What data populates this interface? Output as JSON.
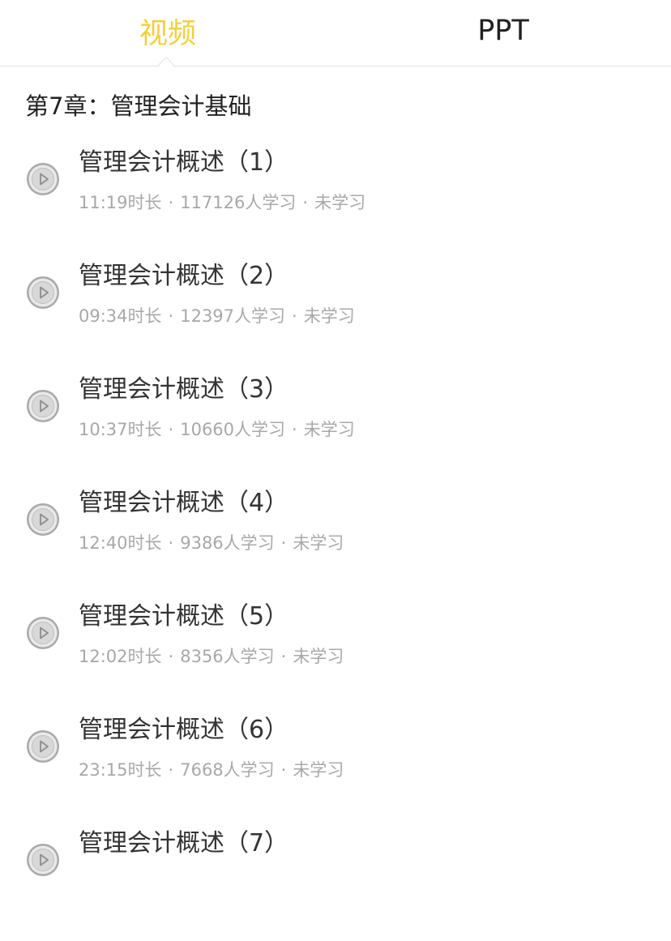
{
  "tabs": [
    {
      "label": "视频",
      "active": true
    },
    {
      "label": "PPT",
      "active": false
    }
  ],
  "colors": {
    "accent": "#f2cf3b",
    "title_text": "#333333",
    "meta_text": "#a8a8a8",
    "divider": "#e2e2e2"
  },
  "chapter": {
    "title": "第7章：管理会计基础"
  },
  "lessons": [
    {
      "title": "管理会计概述（1）",
      "duration": "11:19时长",
      "learners": "117126人学习",
      "status": "未学习",
      "icon": "play-circle-icon"
    },
    {
      "title": "管理会计概述（2）",
      "duration": "09:34时长",
      "learners": "12397人学习",
      "status": "未学习",
      "icon": "play-circle-icon"
    },
    {
      "title": "管理会计概述（3）",
      "duration": "10:37时长",
      "learners": "10660人学习",
      "status": "未学习",
      "icon": "play-circle-icon"
    },
    {
      "title": "管理会计概述（4）",
      "duration": "12:40时长",
      "learners": "9386人学习",
      "status": "未学习",
      "icon": "play-circle-icon"
    },
    {
      "title": "管理会计概述（5）",
      "duration": "12:02时长",
      "learners": "8356人学习",
      "status": "未学习",
      "icon": "play-circle-icon"
    },
    {
      "title": "管理会计概述（6）",
      "duration": "23:15时长",
      "learners": "7668人学习",
      "status": "未学习",
      "icon": "play-circle-icon"
    },
    {
      "title": "管理会计概述（7）",
      "icon": "play-circle-icon"
    }
  ],
  "meta_separator": "·"
}
